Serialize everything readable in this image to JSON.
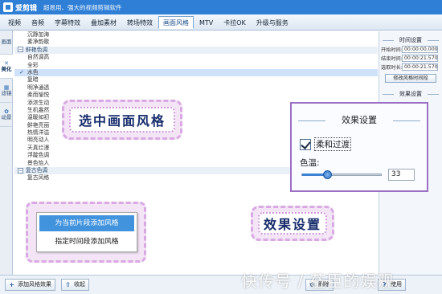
{
  "app": {
    "name": "爱剪辑",
    "slogan": "超易用、强大的视频剪辑软件"
  },
  "menu_tabs": [
    {
      "label": "视频",
      "active": false
    },
    {
      "label": "音频",
      "active": false
    },
    {
      "label": "字幕特效",
      "active": false
    },
    {
      "label": "叠加素材",
      "active": false
    },
    {
      "label": "转场特效",
      "active": false
    },
    {
      "label": "画面风格",
      "active": true
    },
    {
      "label": "MTV",
      "active": false
    },
    {
      "label": "卡拉OK",
      "active": false
    },
    {
      "label": "升级与服务",
      "active": false
    }
  ],
  "side_tabs": [
    {
      "label": "画面",
      "icon": "picture-icon"
    },
    {
      "label": "美化",
      "icon": "wand-icon"
    },
    {
      "label": "滤镜",
      "icon": "filter-icon"
    },
    {
      "label": "动景",
      "icon": "scene-icon"
    }
  ],
  "style_list": [
    {
      "label": "沉静加海",
      "type": "item"
    },
    {
      "label": "素净韵歌",
      "type": "item"
    },
    {
      "label": "鲜艳色调",
      "type": "group"
    },
    {
      "label": "自然调高",
      "type": "item"
    },
    {
      "label": "全彩",
      "type": "item"
    },
    {
      "label": "水色",
      "type": "item",
      "selected": true
    },
    {
      "label": "复暗",
      "type": "item"
    },
    {
      "label": "明净通透",
      "type": "item"
    },
    {
      "label": "柔而愉悦",
      "type": "item"
    },
    {
      "label": "添浓生动",
      "type": "item"
    },
    {
      "label": "生机盎然",
      "type": "item"
    },
    {
      "label": "温暖如初",
      "type": "item"
    },
    {
      "label": "鲜艳亮丽",
      "type": "item"
    },
    {
      "label": "热情洋溢",
      "type": "item"
    },
    {
      "label": "明亮动人",
      "type": "item"
    },
    {
      "label": "天真烂漫",
      "type": "item"
    },
    {
      "label": "浮靛色调",
      "type": "item"
    },
    {
      "label": "景色怡人",
      "type": "item"
    },
    {
      "label": "复古色调",
      "type": "group"
    },
    {
      "label": "复古风格",
      "type": "item"
    }
  ],
  "right_panel": {
    "time_title": "时间设置",
    "start_label": "开始时间:",
    "start_value": "00:00:00.000",
    "end_label": "结束时间:",
    "end_value": "00:00:21.570",
    "duration_label": "选取时长:",
    "duration_value": "00:00:21.570",
    "modify_button": "修改风格时间段",
    "effect_title_small": "效果设置"
  },
  "effect_dialog": {
    "title": "效果设置",
    "checkbox_label": "柔和过渡",
    "checkbox_checked": true,
    "temp_label": "色温:",
    "temp_value": "33",
    "temp_fraction": 0.33
  },
  "popup_menu": {
    "item1": "为当前片段添加风格",
    "item2": "指定时间段添加风格"
  },
  "callouts": {
    "left": "选中画面风格",
    "right": "效果设置"
  },
  "bottom_buttons": {
    "add": "添加风格效果",
    "collapse": "收起",
    "delete": "删除",
    "help": "使用"
  },
  "watermark": "快传号 / 莅臣的娱观"
}
